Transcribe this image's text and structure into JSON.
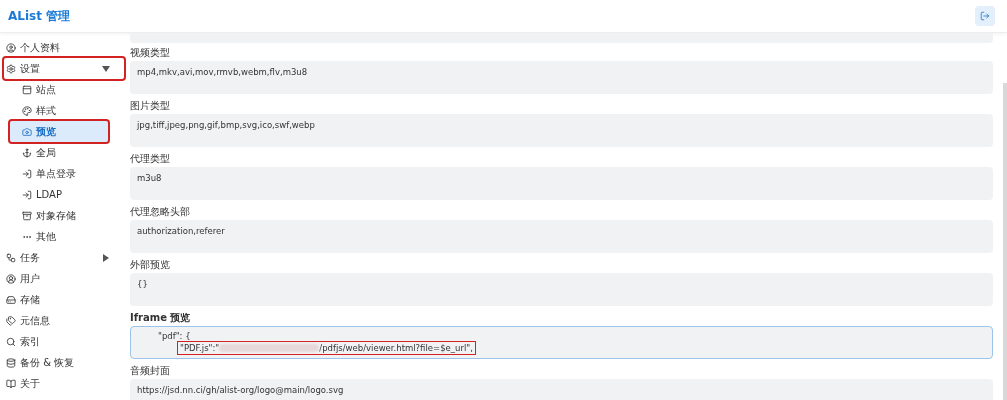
{
  "header": {
    "title": "AList 管理"
  },
  "sidebar": {
    "items": [
      {
        "label": "个人资料",
        "selected": false,
        "highlighted": false
      },
      {
        "label": "设置",
        "selected": false,
        "highlighted": true,
        "expanded": true,
        "children": [
          {
            "label": "站点",
            "selected": false,
            "highlighted": false
          },
          {
            "label": "样式",
            "selected": false,
            "highlighted": false
          },
          {
            "label": "预览",
            "selected": true,
            "highlighted": true
          },
          {
            "label": "全局",
            "selected": false,
            "highlighted": false
          },
          {
            "label": "单点登录",
            "selected": false,
            "highlighted": false
          },
          {
            "label": "LDAP",
            "selected": false,
            "highlighted": false
          },
          {
            "label": "对象存储",
            "selected": false,
            "highlighted": false
          },
          {
            "label": "其他",
            "selected": false,
            "highlighted": false
          }
        ]
      },
      {
        "label": "任务",
        "selected": false,
        "highlighted": false,
        "expanded": false
      },
      {
        "label": "用户",
        "selected": false,
        "highlighted": false
      },
      {
        "label": "存储",
        "selected": false,
        "highlighted": false
      },
      {
        "label": "元信息",
        "selected": false,
        "highlighted": false
      },
      {
        "label": "索引",
        "selected": false,
        "highlighted": false
      },
      {
        "label": "备份 & 恢复",
        "selected": false,
        "highlighted": false
      },
      {
        "label": "关于",
        "selected": false,
        "highlighted": false
      }
    ]
  },
  "fields": [
    {
      "kind": "text",
      "label": "视频类型",
      "value": "mp4,mkv,avi,mov,rmvb,webm,flv,m3u8"
    },
    {
      "kind": "text",
      "label": "图片类型",
      "value": "jpg,tiff,jpeg,png,gif,bmp,svg,ico,swf,webp"
    },
    {
      "kind": "text",
      "label": "代理类型",
      "value": "m3u8"
    },
    {
      "kind": "text",
      "label": "代理忽略头部",
      "value": "authorization,referer"
    },
    {
      "kind": "text",
      "label": "外部预览",
      "value": "{}"
    },
    {
      "kind": "code",
      "label": "Iframe 预览",
      "lines": [
        "\"pdf\": {"
      ],
      "highlight_start": "\"PDF.js\":\"",
      "highlight_end": "/pdfjs/web/viewer.html?file=$e_url\","
    },
    {
      "kind": "text",
      "label": "音频封面",
      "value": "https://jsd.nn.ci/gh/alist-org/logo@main/logo.svg"
    }
  ]
}
